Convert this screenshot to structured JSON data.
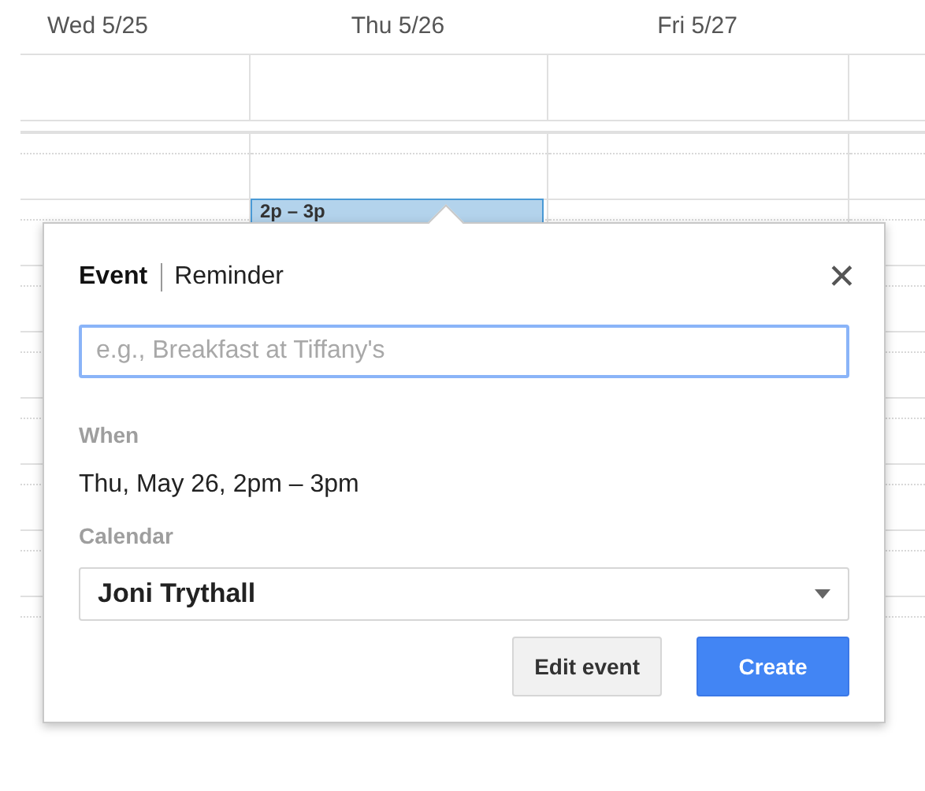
{
  "days": [
    {
      "label": "Wed 5/25"
    },
    {
      "label": "Thu 5/26",
      "event": {
        "time": "2p – 3p"
      }
    },
    {
      "label": "Fri 5/27"
    }
  ],
  "popup": {
    "tabs": [
      {
        "label": "Event",
        "selected": true
      },
      {
        "label": "Reminder",
        "selected": false
      }
    ],
    "close": "✕",
    "title_field": {
      "placeholder": "e.g., Breakfast at Tiffany's"
    },
    "when": {
      "label": "When",
      "value": "Thu, May 26, 2pm – 3pm"
    },
    "calendar": {
      "label": "Calendar",
      "value": "Joni Trythall"
    },
    "buttons": [
      {
        "label": "Edit event",
        "kind": "secondary"
      },
      {
        "label": "Create",
        "kind": "primary"
      }
    ]
  }
}
